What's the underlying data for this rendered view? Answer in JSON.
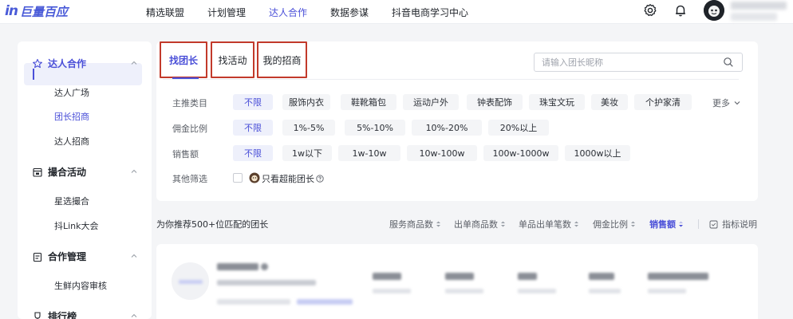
{
  "brand": {
    "in": "in",
    "name": "巨量百应"
  },
  "topnav": {
    "items": [
      "精选联盟",
      "计划管理",
      "达人合作",
      "数据参谋",
      "抖音电商学习中心"
    ],
    "active_index": 2
  },
  "sidebar": {
    "groups": [
      {
        "label": "达人合作",
        "icon": "star-icon",
        "items": [
          "达人广场",
          "团长招商",
          "达人招商"
        ]
      },
      {
        "label": "撮合活动",
        "icon": "calendar-icon",
        "items": [
          "星选撮合",
          "抖Link大会"
        ]
      },
      {
        "label": "合作管理",
        "icon": "clipboard-icon",
        "items": [
          "生鲜内容审核"
        ]
      },
      {
        "label": "排行榜",
        "icon": "trophy-icon",
        "items": []
      }
    ],
    "active_item": "团长招商"
  },
  "tabs": {
    "items": [
      "找团长",
      "找活动",
      "我的招商"
    ],
    "active_index": 0
  },
  "search": {
    "placeholder": "请输入团长昵称",
    "value": ""
  },
  "filters": {
    "category": {
      "label": "主推类目",
      "options": [
        "不限",
        "服饰内衣",
        "鞋靴箱包",
        "运动户外",
        "钟表配饰",
        "珠宝文玩",
        "美妆",
        "个护家清"
      ],
      "selected": "不限",
      "more": "更多"
    },
    "commission": {
      "label": "佣金比例",
      "options": [
        "不限",
        "1%-5%",
        "5%-10%",
        "10%-20%",
        "20%以上"
      ],
      "selected": "不限"
    },
    "sales": {
      "label": "销售额",
      "options": [
        "不限",
        "1w以下",
        "1w-10w",
        "10w-100w",
        "100w-1000w",
        "1000w以上"
      ],
      "selected": "不限"
    },
    "other": {
      "label": "其他筛选",
      "option": "只看超能团长"
    }
  },
  "results": {
    "summary": "为你推荐500+位匹配的团长",
    "sort_fields": [
      "服务商品数",
      "出单商品数",
      "单品出单笔数",
      "佣金比例",
      "销售额"
    ],
    "active_sort": "销售额",
    "metric_help": "指标说明"
  },
  "colors": {
    "accent": "#4a4fd8",
    "highlight_border": "#c23a2b",
    "background": "#f4f5f7"
  }
}
